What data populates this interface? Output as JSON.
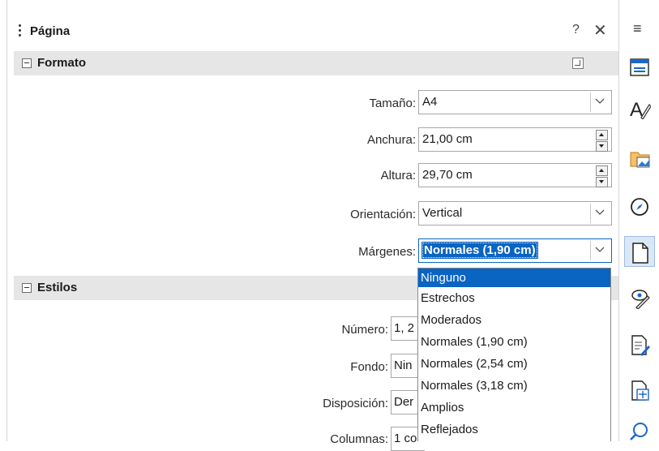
{
  "panel": {
    "title": "Página",
    "help": "?",
    "close": "✕"
  },
  "format": {
    "title": "Formato",
    "size": {
      "label": "Tamaño:",
      "value": "A4"
    },
    "width": {
      "label": "Anchura:",
      "value": "21,00 cm"
    },
    "height": {
      "label": "Altura:",
      "value": "29,70 cm"
    },
    "orientation": {
      "label": "Orientación:",
      "value": "Vertical"
    },
    "margins": {
      "label": "Márgenes:",
      "value": "Normales (1,90 cm)"
    }
  },
  "styles": {
    "title": "Estilos",
    "number": {
      "label": "Número:",
      "value": "1, 2"
    },
    "background": {
      "label": "Fondo:",
      "value": "Nin"
    },
    "layout": {
      "label": "Disposición:",
      "value": "Der"
    },
    "columns": {
      "label": "Columnas:",
      "value": "1 co"
    }
  },
  "margins_dropdown": {
    "selected": "Ninguno",
    "options": [
      "Ninguno",
      "Estrechos",
      "Moderados",
      "Normales (1,90 cm)",
      "Normales (2,54 cm)",
      "Normales (3,18 cm)",
      "Amplios",
      "Reflejados"
    ]
  },
  "sidebar": {
    "icons": [
      "properties-icon",
      "styles-icon",
      "gallery-icon",
      "navigator-icon",
      "page-icon",
      "style-inspector-icon",
      "manage-changes-icon",
      "design-icon",
      "find-icon"
    ],
    "menu": "≡",
    "accent": "#0a64c2"
  }
}
